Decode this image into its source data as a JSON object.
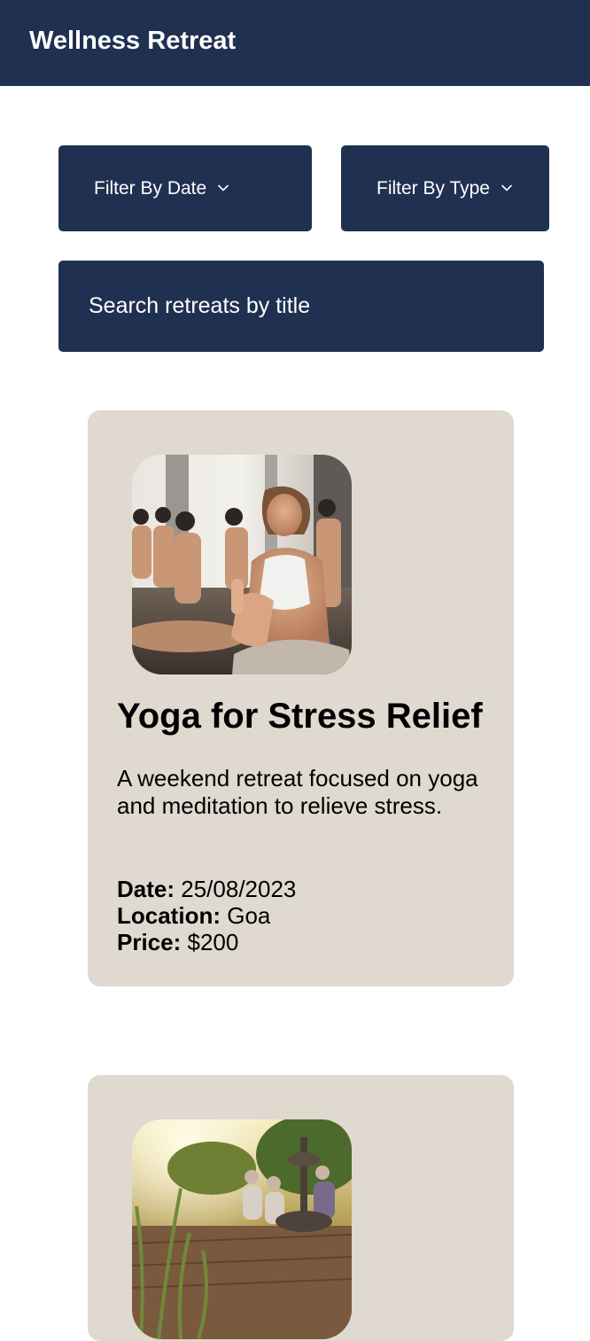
{
  "header": {
    "title": "Wellness Retreat",
    "bg_color": "#203051"
  },
  "filters": {
    "date_label": "Filter By Date",
    "type_label": "Filter By Type",
    "chevron_icon": "chevron-down-icon"
  },
  "search": {
    "placeholder": "Search retreats by title",
    "value": ""
  },
  "retreats": [
    {
      "image": "yoga-class-meditation-photo",
      "title": "Yoga for Stress Relief",
      "description": "A weekend retreat focused on yoga and meditation to relieve stress.",
      "date_label": "Date:",
      "date": "25/08/2023",
      "location_label": "Location:",
      "location": "Goa",
      "price_label": "Price:",
      "price": "$200"
    },
    {
      "image": "outdoor-garden-meditation-photo"
    }
  ],
  "colors": {
    "primary": "#203051",
    "card_bg": "#dfd9d0",
    "text": "#000000"
  }
}
